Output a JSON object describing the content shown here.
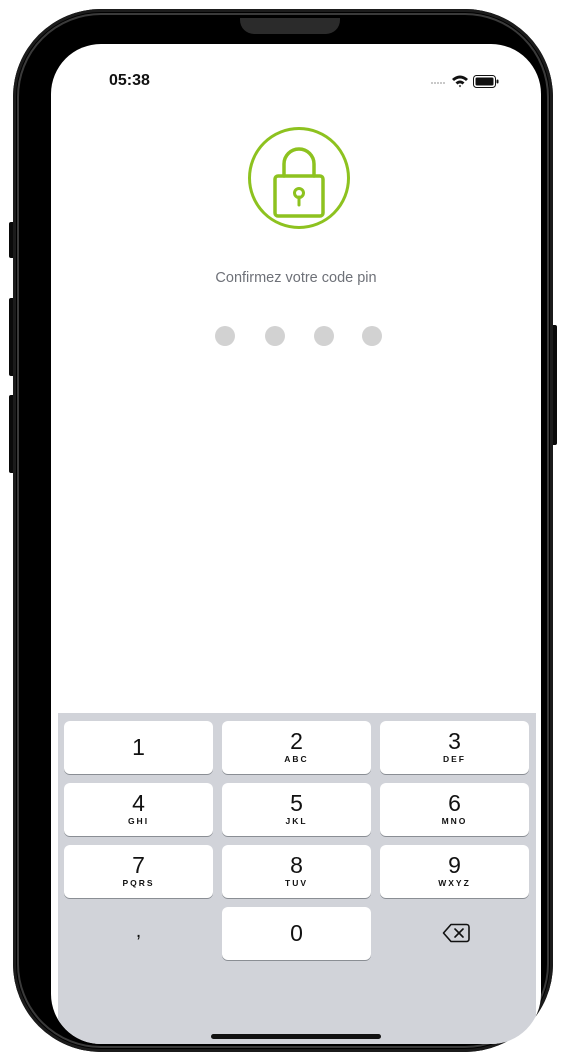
{
  "status_bar": {
    "time": "05:38",
    "icons": [
      "signal-dots-icon",
      "wifi-icon",
      "battery-icon"
    ]
  },
  "lock": {
    "icon": "lock-icon",
    "color": "#8dc21f"
  },
  "prompt": "Confirmez votre code pin",
  "pin": {
    "length": 4,
    "entered": 0,
    "dot_color": "#d2d2d2"
  },
  "keypad": {
    "background": "#d1d3d9",
    "keys": [
      {
        "digit": "1",
        "letters": ""
      },
      {
        "digit": "2",
        "letters": "ABC"
      },
      {
        "digit": "3",
        "letters": "DEF"
      },
      {
        "digit": "4",
        "letters": "GHI"
      },
      {
        "digit": "5",
        "letters": "JKL"
      },
      {
        "digit": "6",
        "letters": "MNO"
      },
      {
        "digit": "7",
        "letters": "PQRS"
      },
      {
        "digit": "8",
        "letters": "TUV"
      },
      {
        "digit": "9",
        "letters": "WXYZ"
      },
      {
        "digit": ",",
        "letters": ""
      },
      {
        "digit": "0",
        "letters": ""
      },
      {
        "digit": "",
        "letters": "",
        "icon": "backspace-icon"
      }
    ]
  }
}
